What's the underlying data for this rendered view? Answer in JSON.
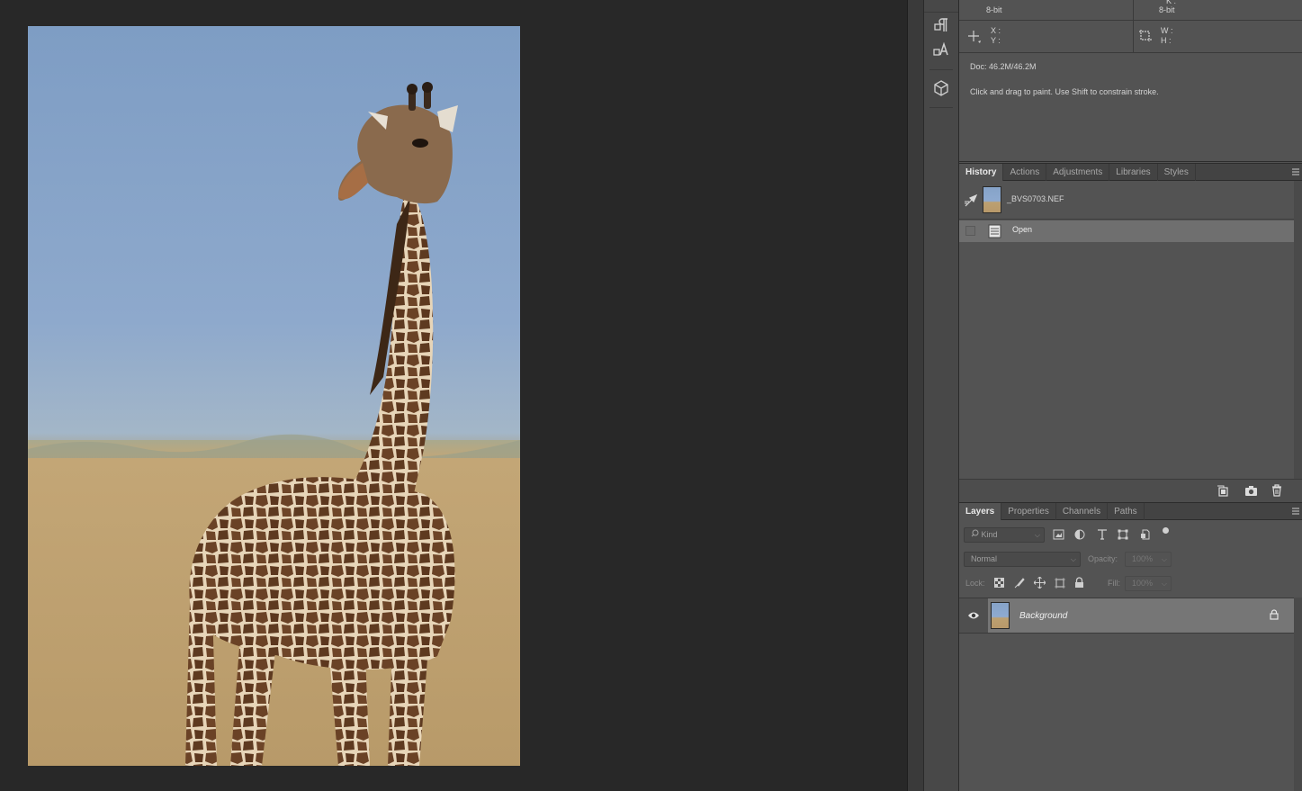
{
  "info": {
    "left_mode_bits": "8-bit",
    "right_mode_label": "K :",
    "right_mode_bits": "8-bit",
    "x_label": "X :",
    "y_label": "Y :",
    "w_label": "W :",
    "h_label": "H :",
    "doc_size": "Doc: 46.2M/46.2M",
    "tool_hint": "Click and drag to paint. Use Shift to constrain stroke."
  },
  "history_tabs": [
    "History",
    "Actions",
    "Adjustments",
    "Libraries",
    "Styles"
  ],
  "history": {
    "snapshot_name": "_BVS0703.NEF",
    "states": [
      "Open"
    ]
  },
  "layers_tabs": [
    "Layers",
    "Properties",
    "Channels",
    "Paths"
  ],
  "layers": {
    "filter_kind": "Kind",
    "blend_mode": "Normal",
    "opacity_label": "Opacity:",
    "opacity_value": "100%",
    "lock_label": "Lock:",
    "fill_label": "Fill:",
    "fill_value": "100%",
    "items": [
      {
        "name": "Background",
        "visible": true,
        "locked": true
      }
    ]
  },
  "colors": {
    "workspace": "#282828",
    "panel": "#535353",
    "selected_row": "#767676"
  }
}
